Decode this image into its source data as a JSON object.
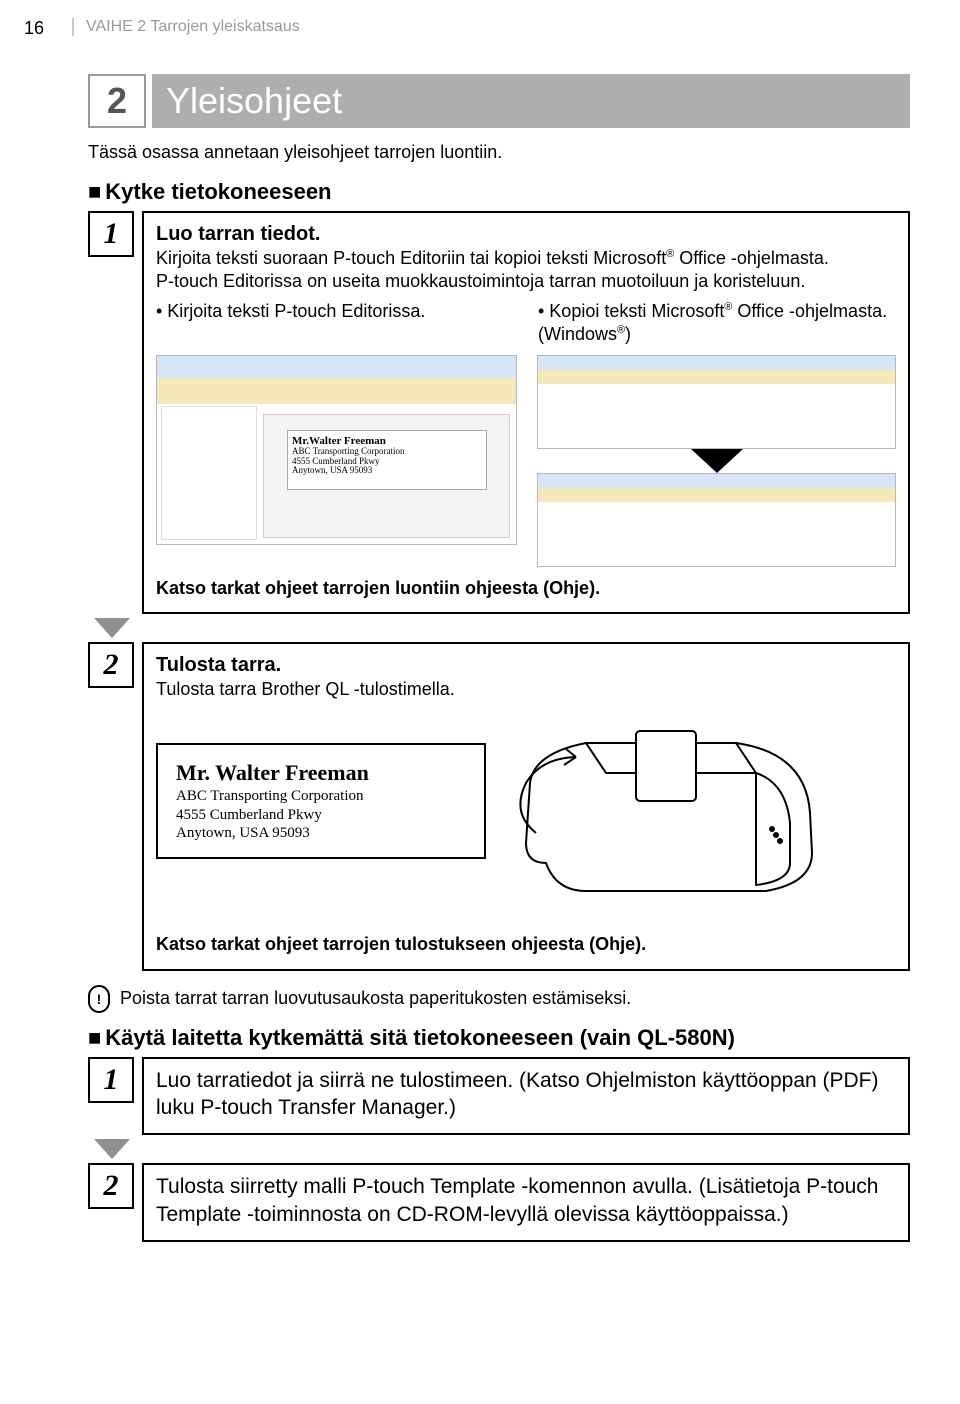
{
  "page_number": "16",
  "header_section": "VAIHE 2 Tarrojen yleiskatsaus",
  "title_number": "2",
  "title_text": "Yleisohjeet",
  "intro": "Tässä osassa annetaan yleisohjeet tarrojen luontiin.",
  "section_a": "Kytke tietokoneeseen",
  "step1": {
    "num": "1",
    "heading": "Luo tarran tiedot.",
    "desc_a": "Kirjoita teksti suoraan P-touch Editoriin tai kopioi teksti Microsoft",
    "desc_a2": " Office -ohjelmasta.",
    "desc_b": "P-touch Editorissa on useita muokkaustoimintoja tarran muotoiluun ja koristeluun.",
    "bullet_left": "• Kirjoita teksti P-touch Editorissa.",
    "bullet_right_a": "• Kopioi teksti Microsoft",
    "bullet_right_b": " Office -ohjelmasta. (Windows",
    "bullet_right_c": ")",
    "sample_name": "Mr.Walter Freeman",
    "sample_lines": "ABC Transporting Corporation\n4555 Cumberland Pkwy\nAnytown, USA 95093",
    "footer": "Katso tarkat ohjeet tarrojen luontiin ohjeesta (Ohje)."
  },
  "step2": {
    "num": "2",
    "heading": "Tulosta tarra.",
    "desc": "Tulosta tarra Brother QL -tulostimella.",
    "addr_name": "Mr. Walter Freeman",
    "addr_l1": "ABC Transporting Corporation",
    "addr_l2": "4555 Cumberland Pkwy",
    "addr_l3": "Anytown, USA 95093",
    "footer": "Katso tarkat ohjeet tarrojen tulostukseen ohjeesta (Ohje)."
  },
  "warning": "Poista tarrat tarran luovutusaukosta paperitukosten estämiseksi.",
  "section_b": "Käytä laitetta kytkemättä sitä tietokoneeseen (vain QL-580N)",
  "stepB1": {
    "num": "1",
    "text": "Luo tarratiedot ja siirrä ne tulostimeen. (Katso Ohjelmiston käyttöoppan (PDF) luku P-touch Transfer Manager.)"
  },
  "stepB2": {
    "num": "2",
    "text": "Tulosta siirretty malli P-touch Template -komennon avulla. (Lisätietoja P-touch Template -toiminnosta on CD-ROM-levyllä olevissa käyttöoppaissa.)"
  }
}
